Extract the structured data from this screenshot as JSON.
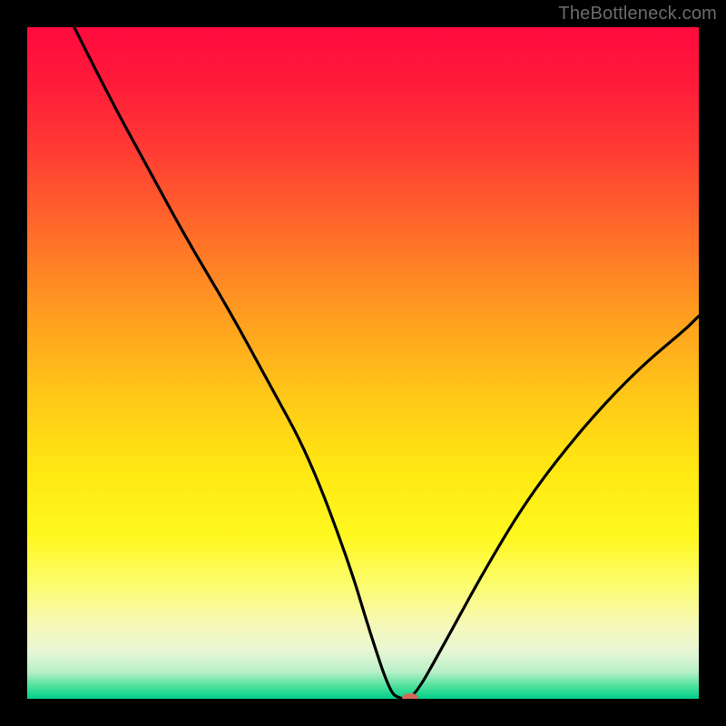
{
  "watermark": "TheBottleneck.com",
  "chart_data": {
    "type": "line",
    "title": "",
    "xlabel": "",
    "ylabel": "",
    "xlim": [
      0,
      100
    ],
    "ylim": [
      0,
      100
    ],
    "background_gradient": {
      "orientation": "vertical",
      "stops": [
        {
          "pos": 0,
          "color": "#ff0a3e"
        },
        {
          "pos": 8,
          "color": "#ff1a3a"
        },
        {
          "pos": 18,
          "color": "#ff3a34"
        },
        {
          "pos": 30,
          "color": "#ff6a2a"
        },
        {
          "pos": 42,
          "color": "#ff9a20"
        },
        {
          "pos": 55,
          "color": "#ffc818"
        },
        {
          "pos": 66,
          "color": "#ffe812"
        },
        {
          "pos": 76,
          "color": "#fff820"
        },
        {
          "pos": 83,
          "color": "#fcfc6e"
        },
        {
          "pos": 89,
          "color": "#f6f8b8"
        },
        {
          "pos": 93,
          "color": "#e6f6d4"
        },
        {
          "pos": 96,
          "color": "#b8f0c8"
        },
        {
          "pos": 98,
          "color": "#53e29e"
        },
        {
          "pos": 100,
          "color": "#00d08a"
        }
      ]
    },
    "series": [
      {
        "name": "bottleneck-curve",
        "color": "#000000",
        "x": [
          7,
          12,
          18,
          24,
          30,
          36,
          42,
          48,
          51,
          54,
          55.5,
          57.5,
          62,
          68,
          74,
          80,
          86,
          92,
          98,
          100
        ],
        "y": [
          100,
          90,
          79,
          68,
          58,
          47,
          36,
          20,
          10,
          1,
          0,
          0,
          8,
          19,
          29,
          37,
          44,
          50,
          55,
          57
        ]
      }
    ],
    "marker": {
      "x": 57,
      "y": 0,
      "color": "#d46a5a"
    },
    "frame_color": "#000000",
    "frame_thickness_px": 30
  }
}
